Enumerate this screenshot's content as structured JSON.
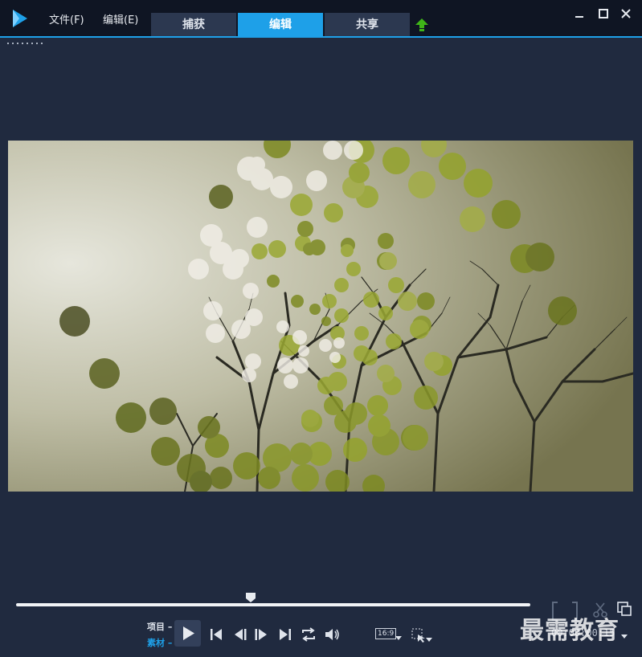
{
  "menu": {
    "file": "文件(F)",
    "edit": "编辑(E)"
  },
  "tabs": [
    {
      "label": "捕获",
      "active": false
    },
    {
      "label": "编辑",
      "active": true
    },
    {
      "label": "共享",
      "active": false
    }
  ],
  "window_controls": [
    "minimize-icon",
    "maximize-icon",
    "close-icon"
  ],
  "player": {
    "mode_project": "项目",
    "mode_clip": "素材",
    "aspect_ratio": "16:9",
    "timecode": "00:00:00:15",
    "playhead_fraction": 0.46
  },
  "watermark": "最需教育",
  "colors": {
    "accent": "#1ea0e8",
    "upload_green": "#3fb618",
    "background": "#202a3f"
  }
}
